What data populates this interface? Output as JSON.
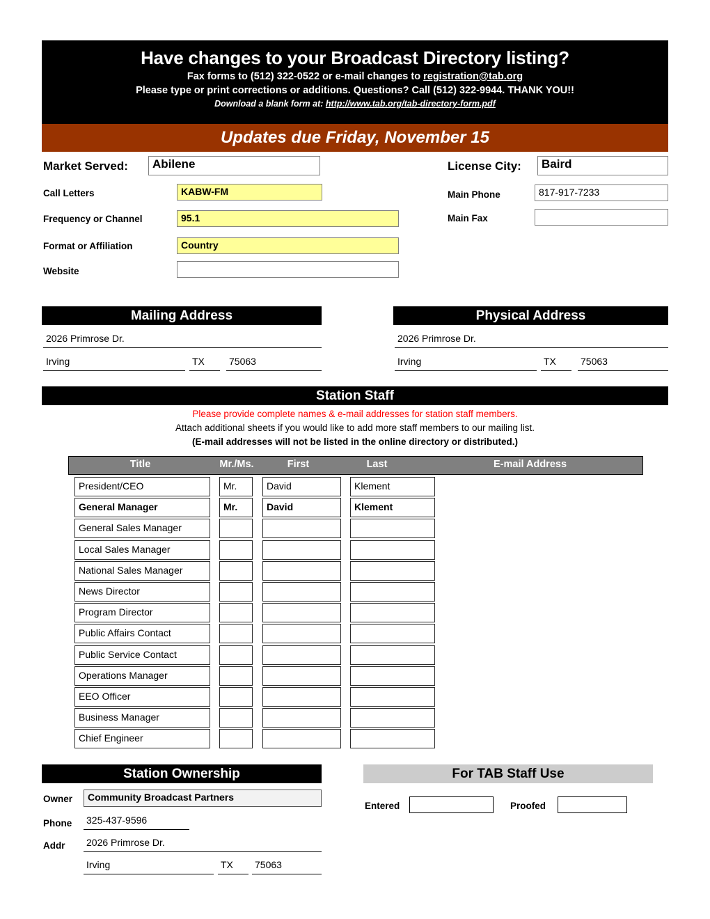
{
  "masthead": {
    "title": "Have changes to your Broadcast Directory listing?",
    "line2_pre": "Fax forms to (512) 322-0522 or e-mail changes to ",
    "line2_link": "registration@tab.org",
    "line3": "Please type or print corrections or additions. Questions?  Call (512) 322-9944. THANK YOU!!",
    "line4_pre": "Download a blank form at: ",
    "line4_link": "http://www.tab.org/tab-directory-form.pdf"
  },
  "due_banner": "Updates due Friday, November 15",
  "station": {
    "market_served_label": "Market Served:",
    "market_served_value": "Abilene",
    "license_city_label": "License City:",
    "license_city_value": "Baird",
    "call_letters_label": "Call Letters",
    "call_letters_value": "KABW-FM",
    "main_phone_label": "Main Phone",
    "main_phone_value": "817-917-7233",
    "frequency_label": "Frequency or Channel",
    "frequency_value": "95.1",
    "main_fax_label": "Main Fax",
    "main_fax_value": "",
    "format_label": "Format or Affiliation",
    "format_value": "Country",
    "website_label": "Website",
    "website_value": ""
  },
  "mailing_address": {
    "header": "Mailing Address",
    "street": "2026 Primrose Dr.",
    "city": "Irving",
    "state": "TX",
    "zip": "75063"
  },
  "physical_address": {
    "header": "Physical Address",
    "street": "2026 Primrose Dr.",
    "city": "Irving",
    "state": "TX",
    "zip": "75063"
  },
  "station_staff": {
    "header": "Station Staff",
    "instruction_red": "Please provide complete names & e-mail addresses for station staff members.",
    "instruction_plain": "Attach additional sheets if you would like to add more staff members to our mailing list.",
    "instruction_bold": "(E-mail addresses will not be listed in the online directory or distributed.)",
    "columns": [
      "Title",
      "Mr./Ms.",
      "First",
      "Last",
      "E-mail Address"
    ],
    "rows": [
      {
        "title": "President/CEO",
        "salutation": "Mr.",
        "first": "David",
        "last": "Klement",
        "email": "",
        "bold": false
      },
      {
        "title": "General Manager",
        "salutation": "Mr.",
        "first": "David",
        "last": "Klement",
        "email": "",
        "bold": true
      },
      {
        "title": "General Sales Manager",
        "salutation": "",
        "first": "",
        "last": "",
        "email": "",
        "bold": false
      },
      {
        "title": "Local Sales Manager",
        "salutation": "",
        "first": "",
        "last": "",
        "email": "",
        "bold": false
      },
      {
        "title": "National Sales Manager",
        "salutation": "",
        "first": "",
        "last": "",
        "email": "",
        "bold": false
      },
      {
        "title": "News Director",
        "salutation": "",
        "first": "",
        "last": "",
        "email": "",
        "bold": false
      },
      {
        "title": "Program Director",
        "salutation": "",
        "first": "",
        "last": "",
        "email": "",
        "bold": false
      },
      {
        "title": "Public Affairs Contact",
        "salutation": "",
        "first": "",
        "last": "",
        "email": "",
        "bold": false
      },
      {
        "title": "Public Service Contact",
        "salutation": "",
        "first": "",
        "last": "",
        "email": "",
        "bold": false
      },
      {
        "title": "Operations Manager",
        "salutation": "",
        "first": "",
        "last": "",
        "email": "",
        "bold": false
      },
      {
        "title": "EEO Officer",
        "salutation": "",
        "first": "",
        "last": "",
        "email": "",
        "bold": false
      },
      {
        "title": "Business Manager",
        "salutation": "",
        "first": "",
        "last": "",
        "email": "",
        "bold": false
      },
      {
        "title": "Chief Engineer",
        "salutation": "",
        "first": "",
        "last": "",
        "email": "",
        "bold": false
      }
    ]
  },
  "ownership": {
    "header": "Station Ownership",
    "owner_label": "Owner",
    "owner_value": "Community Broadcast Partners",
    "phone_label": "Phone",
    "phone_value": "325-437-9596",
    "addr_label": "Addr",
    "addr_value": "2026 Primrose Dr.",
    "city": "Irving",
    "state": "TX",
    "zip": "75063"
  },
  "tab_staff_use": {
    "header": "For TAB Staff Use",
    "entered_label": "Entered",
    "entered_value": "",
    "proofed_label": "Proofed",
    "proofed_value": ""
  },
  "colors": {
    "banner_orange": "#993300",
    "highlight_yellow": "#FFFF99",
    "header_black": "#000000",
    "table_header_gray": "#808080",
    "section_gray": "#cccccc",
    "alert_red": "#ff0000"
  }
}
